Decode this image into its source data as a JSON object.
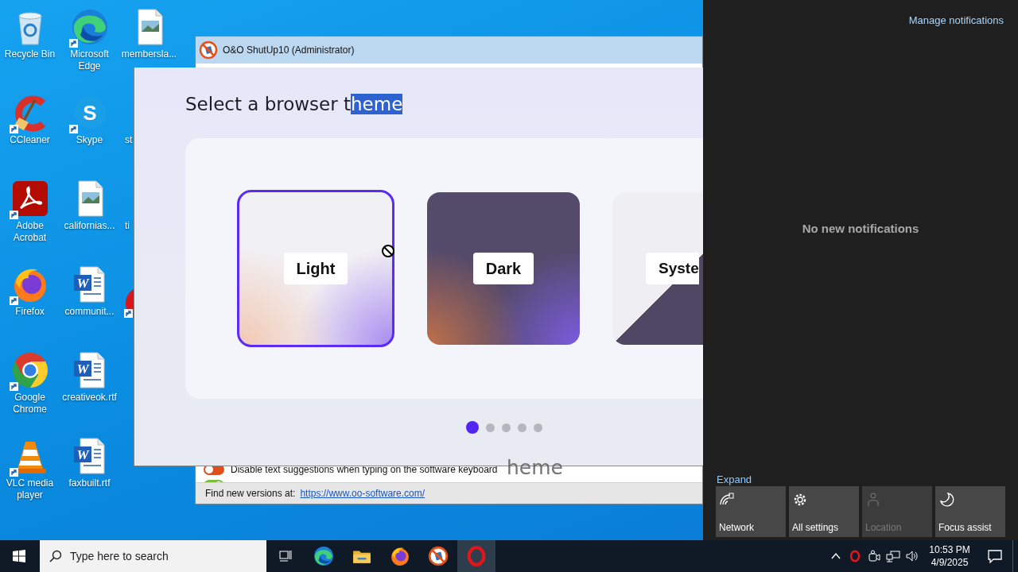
{
  "desktop_icons": [
    {
      "label": "Recycle Bin",
      "kind": "recycle-bin",
      "shortcut": false
    },
    {
      "label": "CCleaner",
      "kind": "ccleaner",
      "shortcut": true
    },
    {
      "label": "Adobe Acrobat",
      "kind": "acrobat",
      "shortcut": true
    },
    {
      "label": "Firefox",
      "kind": "firefox",
      "shortcut": true
    },
    {
      "label": "Google Chrome",
      "kind": "chrome",
      "shortcut": true
    },
    {
      "label": "VLC media player",
      "kind": "vlc",
      "shortcut": true
    },
    {
      "label": "Microsoft Edge",
      "kind": "edge",
      "shortcut": true
    },
    {
      "label": "Skype",
      "kind": "skype",
      "glyph": "S",
      "shortcut": true
    },
    {
      "label": "californias...",
      "kind": "image-file",
      "shortcut": false
    },
    {
      "label": "communit...",
      "kind": "word-file",
      "glyph": "W",
      "shortcut": false
    },
    {
      "label": "creativeok.rtf",
      "kind": "word-file",
      "glyph": "W",
      "shortcut": false
    },
    {
      "label": "faxbuilt.rtf",
      "kind": "word-file",
      "glyph": "W",
      "shortcut": false
    },
    {
      "label": "membersla...",
      "kind": "image-file",
      "shortcut": false
    },
    {
      "label": "st",
      "kind": "partial",
      "shortcut": false
    },
    {
      "label": "ti",
      "kind": "partial",
      "shortcut": false
    },
    {
      "kind": "partial-app",
      "shortcut": true
    }
  ],
  "shutup_window": {
    "title": "O&O ShutUp10 (Administrator)",
    "settings": [
      {
        "label": "Disable text suggestions when typing on the software keyboard",
        "on": false
      },
      {
        "on": true
      }
    ],
    "footer_label": "Find new versions at:",
    "footer_link": "https://www.oo-software.com/"
  },
  "browser_setup": {
    "heading": "Select a browser t",
    "heading_selected": "heme",
    "themes": [
      {
        "label": "Light",
        "kind": "light",
        "selected": true
      },
      {
        "label": "Dark",
        "kind": "dark",
        "selected": false
      },
      {
        "label": "Syste",
        "kind": "system",
        "selected": false
      }
    ],
    "pages": [
      {
        "selected": true
      },
      {
        "selected": false
      },
      {
        "selected": false
      },
      {
        "selected": false
      },
      {
        "selected": false
      }
    ]
  },
  "drag_ghost": "heme",
  "action_center": {
    "manage_link": "Manage notifications",
    "empty_message": "No new notifications",
    "expand_link": "Expand",
    "tiles": [
      {
        "label": "Network",
        "kind": "network",
        "disabled": false
      },
      {
        "label": "All settings",
        "kind": "settings",
        "disabled": false
      },
      {
        "label": "Location",
        "kind": "location",
        "disabled": true
      },
      {
        "label": "Focus assist",
        "kind": "focus",
        "disabled": false
      }
    ]
  },
  "taskbar": {
    "search_placeholder": "Type here to search",
    "apps": [
      {
        "kind": "edge",
        "selected": false
      },
      {
        "kind": "explorer",
        "selected": false
      },
      {
        "kind": "firefox",
        "selected": false
      },
      {
        "kind": "shutup",
        "selected": false
      },
      {
        "kind": "opera",
        "selected": true
      }
    ],
    "tray": [
      {
        "kind": "chevron"
      },
      {
        "kind": "opera"
      },
      {
        "kind": "meet"
      },
      {
        "kind": "network"
      },
      {
        "kind": "volume"
      }
    ],
    "time": "10:53 PM",
    "date": "4/9/2025"
  }
}
